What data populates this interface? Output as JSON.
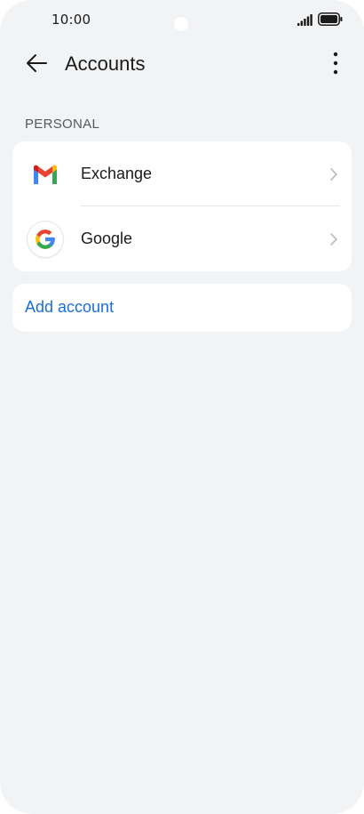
{
  "status_bar": {
    "time": "10:00"
  },
  "header": {
    "title": "Accounts",
    "back_icon": "arrow-left-icon",
    "more_icon": "more-vertical-icon"
  },
  "section": {
    "label": "PERSONAL"
  },
  "accounts": [
    {
      "name": "Exchange",
      "icon": "gmail-icon"
    },
    {
      "name": "Google",
      "icon": "google-icon"
    }
  ],
  "add_account": {
    "label": "Add account"
  },
  "colors": {
    "background": "#f1f3f5",
    "card": "#ffffff",
    "accent": "#1a6fd6",
    "text": "#1a1a1a",
    "secondary_text": "#555a60"
  }
}
